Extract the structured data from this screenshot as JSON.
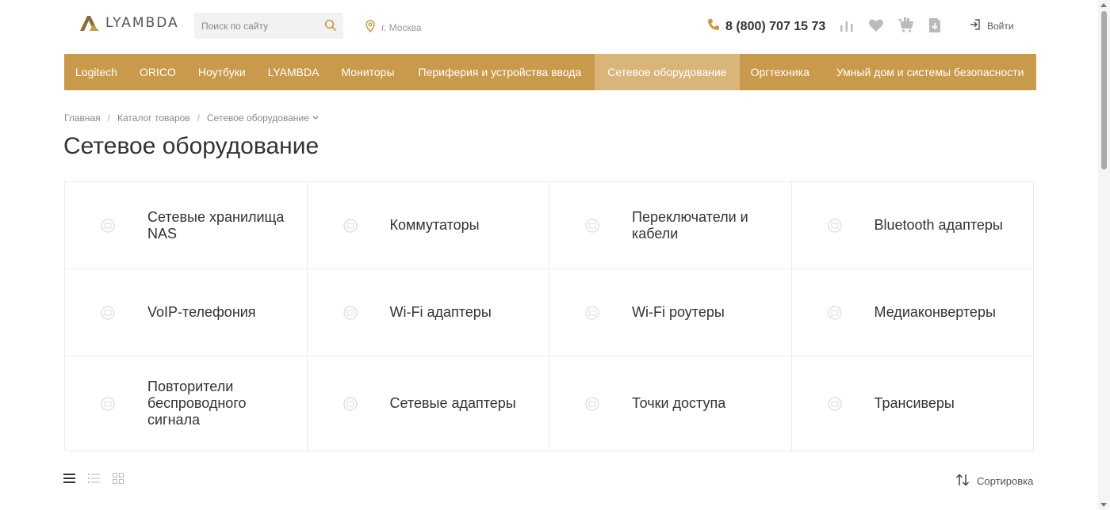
{
  "header": {
    "logo_text": "LYAMBDA",
    "search_placeholder": "Поиск по сайту",
    "city": "г. Москва",
    "phone": "8 (800) 707 15 73",
    "login": "Войти"
  },
  "nav": {
    "items": [
      {
        "label": "Logitech"
      },
      {
        "label": "ORICO"
      },
      {
        "label": "Ноутбуки"
      },
      {
        "label": "LYAMBDA"
      },
      {
        "label": "Мониторы"
      },
      {
        "label": "Периферия и устройства ввода"
      },
      {
        "label": "Сетевое оборудование"
      },
      {
        "label": "Оргтехника"
      },
      {
        "label": "Умный дом и системы безопасности"
      },
      {
        "label": "···"
      }
    ]
  },
  "breadcrumb": {
    "home": "Главная",
    "catalog": "Каталог товаров",
    "current": "Сетевое оборудование",
    "sep": "/"
  },
  "page": {
    "title": "Сетевое оборудование"
  },
  "categories": [
    {
      "label": "Сетевые хранилища NAS"
    },
    {
      "label": "Коммутаторы"
    },
    {
      "label": "Переключатели и кабели"
    },
    {
      "label": "Bluetooth адаптеры"
    },
    {
      "label": "VoIP-телефония"
    },
    {
      "label": "Wi-Fi адаптеры"
    },
    {
      "label": "Wi-Fi роутеры"
    },
    {
      "label": "Медиаконвертеры"
    },
    {
      "label": "Повторители беспроводного сигнала"
    },
    {
      "label": "Сетевые адаптеры"
    },
    {
      "label": "Точки доступа"
    },
    {
      "label": "Трансиверы"
    }
  ],
  "toolbar": {
    "sort_label": "Сортировка"
  },
  "colors": {
    "accent": "#c99a4b",
    "nav_active": "#d9b57a"
  }
}
